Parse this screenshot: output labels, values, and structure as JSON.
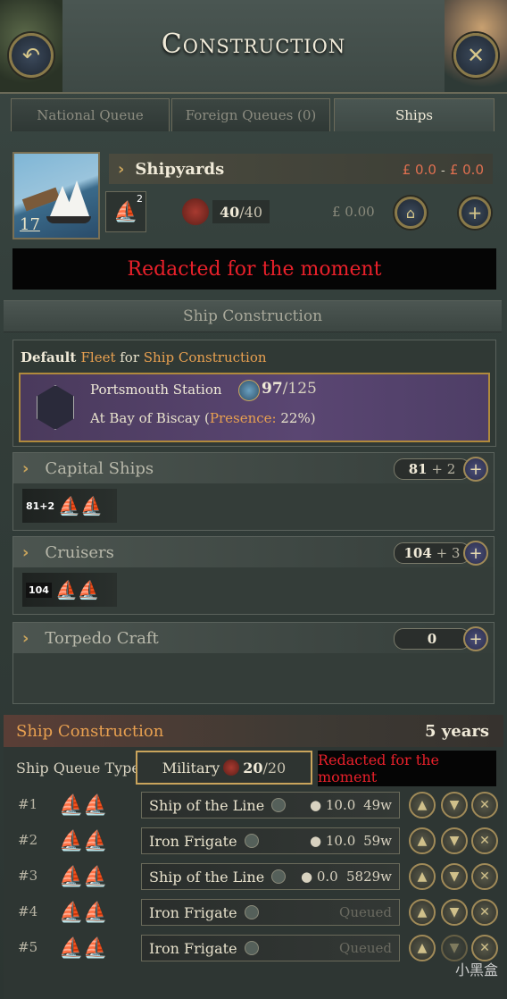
{
  "header": {
    "title": "Construction",
    "back_label": "↶",
    "close_label": "✕"
  },
  "tabs": [
    {
      "label": "National Queue",
      "active": false
    },
    {
      "label": "Foreign Queues (0)",
      "active": false
    },
    {
      "label": "Ships",
      "active": true
    }
  ],
  "shipyard": {
    "name": "Shipyards",
    "income_from": "£ 0.0",
    "income_dash": "-",
    "income_to": "£ 0.0",
    "ship_count": "17",
    "ship_type_badge": "2",
    "supply_current": "40",
    "supply_max": "/40",
    "cost": "£ 0.00",
    "redacted": "Redacted for the moment"
  },
  "ship_construction_title": "Ship Construction",
  "fleet": {
    "heading_default": "Default ",
    "heading_fleet": "Fleet",
    "heading_for": " for ",
    "heading_target": "Ship Construction",
    "name": "Portsmouth Station",
    "strength_current": "97",
    "strength_max": "/125",
    "location_prefix": "At ",
    "location": "Bay of Biscay",
    "presence_open": " (",
    "presence_label": "Presence:",
    "presence_value": " 22%",
    "presence_close": ")"
  },
  "categories": [
    {
      "name": "Capital Ships",
      "count": "81",
      "add": "+ 2",
      "chip": "81+2",
      "ship_color": "#c9a23a"
    },
    {
      "name": "Cruisers",
      "count": "104",
      "add": "+ 3",
      "chip": "104",
      "ship_color": "#4a8ac0"
    },
    {
      "name": "Torpedo Craft",
      "count": "0",
      "add": "",
      "chip": "",
      "ship_color": ""
    }
  ],
  "queue": {
    "title": "Ship Construction",
    "duration": "5 years",
    "type_label": "Ship Queue Type",
    "type_value": "Military",
    "type_current": "20",
    "type_max": "/20",
    "redacted": "Redacted for the moment",
    "rows": [
      {
        "pos": "#1",
        "name": "Ship of the Line",
        "rate": "10.0",
        "time": "49w",
        "status": "",
        "ship_color": "#c9a23a"
      },
      {
        "pos": "#2",
        "name": "Iron Frigate",
        "rate": "10.0",
        "time": "59w",
        "status": "",
        "ship_color": "#4a8ac0"
      },
      {
        "pos": "#3",
        "name": "Ship of the Line",
        "rate": "0.0",
        "time": "5829w",
        "status": "",
        "ship_color": "#c9a23a"
      },
      {
        "pos": "#4",
        "name": "Iron Frigate",
        "rate": "",
        "time": "",
        "status": "Queued",
        "ship_color": "#4a8ac0"
      },
      {
        "pos": "#5",
        "name": "Iron Frigate",
        "rate": "",
        "time": "",
        "status": "Queued",
        "ship_color": "#4a8ac0"
      }
    ]
  },
  "watermark": "小黑盒"
}
